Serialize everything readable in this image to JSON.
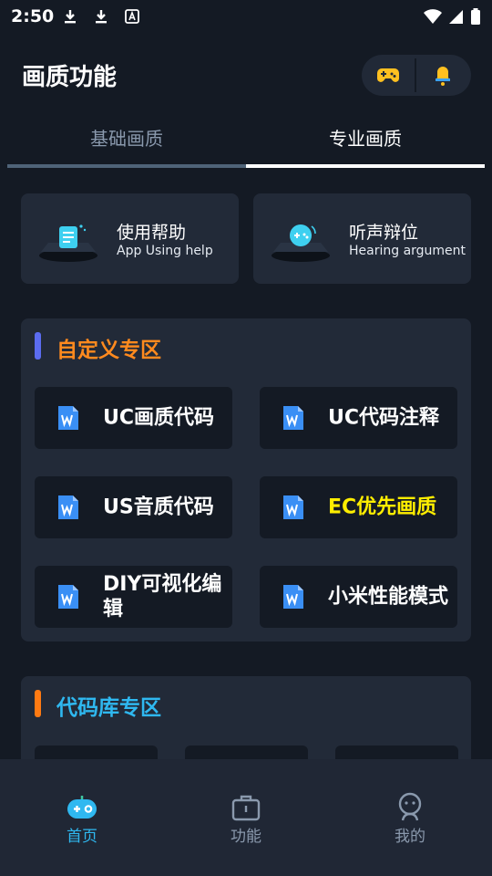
{
  "status_bar": {
    "time": "2:50"
  },
  "header": {
    "title": "画质功能"
  },
  "tabs": [
    {
      "label": "基础画质",
      "active": false
    },
    {
      "label": "专业画质",
      "active": true
    }
  ],
  "help_cards": [
    {
      "title": "使用帮助",
      "subtitle": "App Using help"
    },
    {
      "title": "听声辩位",
      "subtitle": "Hearing argument"
    }
  ],
  "section_custom": {
    "title": "自定义专区",
    "accent": "#ff8a1e",
    "bar_color": "#5b6cf0",
    "items": [
      {
        "label": "UC画质代码",
        "color": "#ffffff"
      },
      {
        "label": "UC代码注释",
        "color": "#ffffff"
      },
      {
        "label": "US音质代码",
        "color": "#ffffff"
      },
      {
        "label": "EC优先画质",
        "color": "#ffee00"
      },
      {
        "label": "DIY可视化编辑",
        "color": "#ffffff"
      },
      {
        "label": "小米性能模式",
        "color": "#ffffff"
      }
    ]
  },
  "section_library": {
    "title": "代码库专区",
    "accent": "#2fb8f0",
    "bar_color": "#ff7a12"
  },
  "bottom_nav": [
    {
      "label": "首页",
      "active": true,
      "icon": "gamepad-icon"
    },
    {
      "label": "功能",
      "active": false,
      "icon": "toolbox-icon"
    },
    {
      "label": "我的",
      "active": false,
      "icon": "profile-icon"
    }
  ],
  "colors": {
    "background": "#141a24",
    "card": "#222a38",
    "nav_active": "#2fb8f0",
    "nav_inactive": "#8a99ad"
  }
}
